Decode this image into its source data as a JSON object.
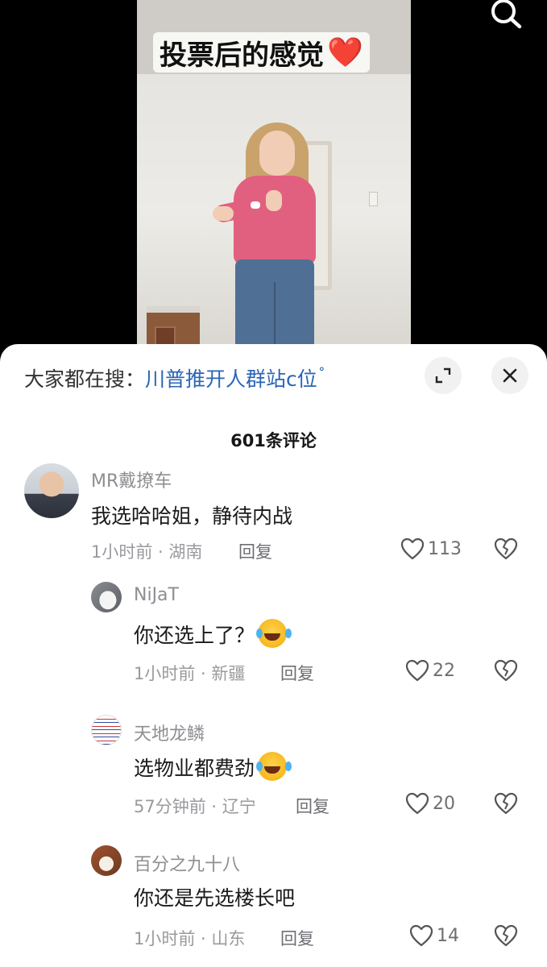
{
  "video": {
    "caption": "投票后的感觉",
    "caption_emoji": "❤️"
  },
  "icons": {
    "search": "search-icon",
    "expand": "expand-icon",
    "close": "close-icon",
    "like": "heart-outline-icon",
    "dislike": "broken-heart-icon"
  },
  "colors": {
    "link": "#2a64b6",
    "sheet_bg": "#ffffff",
    "muted": "#9a9a9e"
  },
  "sheet": {
    "hot_search_label": "大家都在搜：",
    "hot_search_query": "川普推开人群站c位",
    "hot_search_suffix": "ᐤ",
    "comment_count": "601条评论"
  },
  "comments": [
    {
      "username": "MR戴撩车",
      "text": "我选哈哈姐，静待内战",
      "time_location": "1小时前 · 湖南",
      "reply_label": "回复",
      "likes": "113"
    },
    {
      "username": "NiJaT",
      "text": "你还选上了？",
      "time_location": "1小时前 · 新疆",
      "reply_label": "回复",
      "likes": "22"
    },
    {
      "username": "天地龙鳞",
      "text": "选物业都费劲",
      "time_location": "57分钟前 · 辽宁",
      "reply_label": "回复",
      "likes": "20"
    },
    {
      "username": "百分之九十八",
      "text": "你还是先选楼长吧",
      "time_location": "1小时前 · 山东",
      "reply_label": "回复",
      "likes": "14"
    }
  ]
}
